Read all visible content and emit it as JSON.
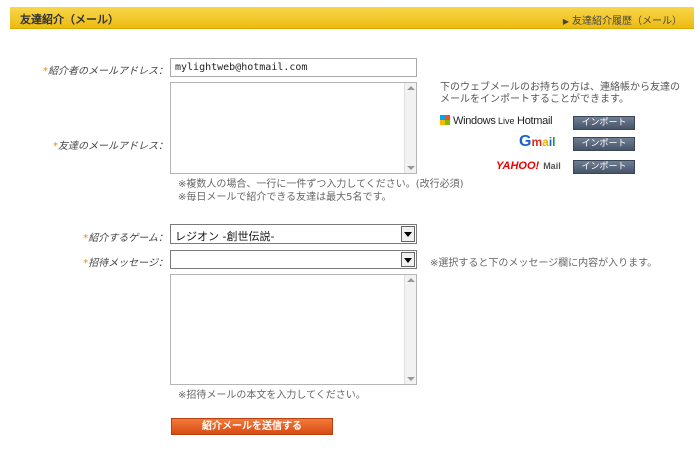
{
  "header": {
    "title": "友達紹介（メール）",
    "history_link": "友達紹介履歴（メール）"
  },
  "form": {
    "sender_label": "紹介者のメールアドレス：",
    "sender_value": "mylightweb@hotmail.com",
    "friends_label": "友達のメールアドレス：",
    "friends_note_1": "※複数人の場合、一行に一件ずつ入力してください。(改行必須)",
    "friends_note_2": "※毎日メールで紹介できる友達は最大5名です。",
    "game_label": "紹介するゲーム：",
    "game_value": "レジオン -創世伝説-",
    "template_label": "招待メッセージ：",
    "template_value": "",
    "template_note": "※選択すると下のメッセージ欄に内容が入ります。",
    "message_note": "※招待メールの本文を入力してください。",
    "send_button": "紹介メールを送信する"
  },
  "import": {
    "description": "下のウェブメールのお持ちの方は、連絡帳から友達のメールをインポートすることができます。",
    "providers": [
      {
        "name": "Windows Live Hotmail",
        "button": "インポート"
      },
      {
        "name": "Gmail",
        "button": "インポート"
      },
      {
        "name": "YAHOO! Mail",
        "button": "インポート"
      }
    ]
  },
  "colors": {
    "header": "#f2c830",
    "required": "#f18a00",
    "send_button": "#e05a1e",
    "import_button": "#56657a"
  }
}
